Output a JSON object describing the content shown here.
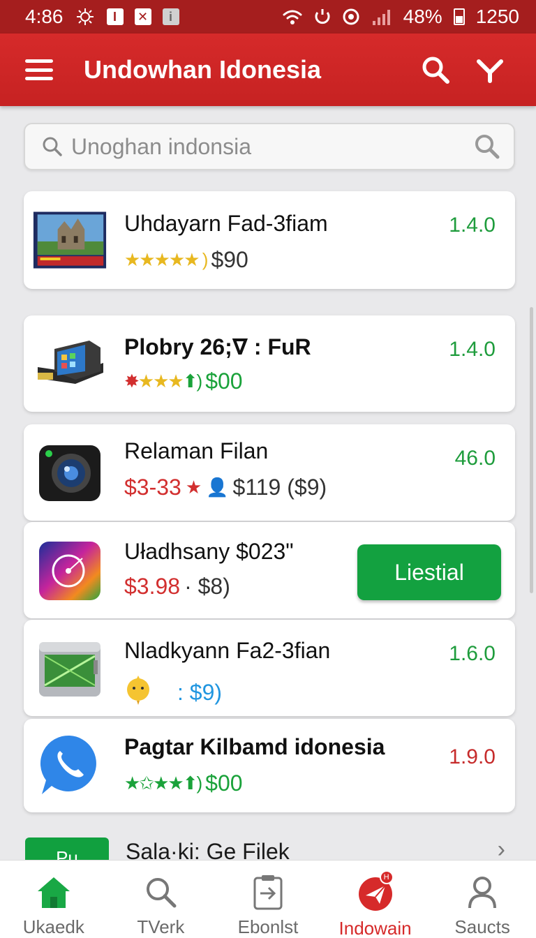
{
  "status_bar": {
    "time": "4:86",
    "battery": "48%",
    "clock_right": "1250",
    "icons": [
      "gear-icon",
      "notification-box-icon",
      "close-box-icon",
      "info-box-icon",
      "wifi-icon",
      "sync-icon",
      "alarm-icon",
      "signal-icon",
      "battery-icon"
    ]
  },
  "app_bar": {
    "title": "Undowhan Idonesia",
    "icons": [
      "menu-icon",
      "search-icon",
      "dropdown-chevron-icon"
    ]
  },
  "search": {
    "placeholder": "Unoghan indonsia"
  },
  "apps": [
    {
      "title": "Uhdayarn Fad-3fiam",
      "rating_glyphs": "★★★★★ )",
      "price": "$90",
      "version": "1.4.0",
      "icon": "castle-book-icon"
    },
    {
      "title": "Plobry 26;∇ : FuR",
      "rating_glyphs": "✸★★★⬆)",
      "price": "$00",
      "version": "1.4.0",
      "icon": "device-icon"
    },
    {
      "title": "Relaman Filan",
      "price_red": "$3-33",
      "price": "$119 ($9)",
      "version": "46.0",
      "icon": "camera-icon"
    },
    {
      "title": "Uładhsany $023\"",
      "price_red": "$3.98",
      "price": "· $8)",
      "button": "Liestial",
      "icon": "disc-icon"
    },
    {
      "title": "Nladkyann Fa2-3fian",
      "price": ": $9)",
      "version": "1.6.0",
      "icon": "tablet-icon"
    },
    {
      "title": "Pagtar Kilbamd idonesia",
      "rating_glyphs": "★✩★★⬆)",
      "price": "$00",
      "version": "1.9.0",
      "icon": "phone-chat-icon"
    }
  ],
  "partial": {
    "badge": "Pu",
    "title": "Sala·ki: Ge Filek"
  },
  "bottom_nav": [
    {
      "label": "Ukaedk",
      "icon": "home-icon"
    },
    {
      "label": "TVerk",
      "icon": "search-icon"
    },
    {
      "label": "Ebonlst",
      "icon": "clipboard-arrow-icon"
    },
    {
      "label": "Indowain",
      "icon": "send-icon",
      "badge": "H"
    },
    {
      "label": "Saucts",
      "icon": "user-icon"
    }
  ],
  "colors": {
    "primary": "#d62a2a",
    "status": "#a51e1e",
    "accent_green": "#13a140"
  }
}
